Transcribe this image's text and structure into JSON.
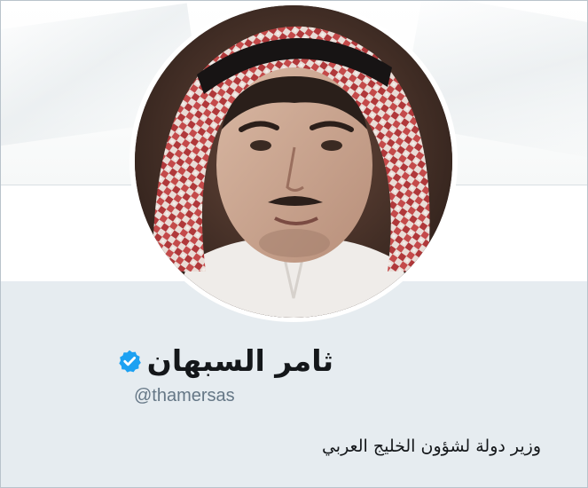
{
  "profile": {
    "display_name": "ثامر السبهان",
    "verified": true,
    "verified_badge_color": "#1da1f2",
    "handle": "@thamersas",
    "bio": "وزير دولة لشؤون الخليج العربي"
  },
  "colors": {
    "card_background": "#e6ecf0",
    "handle_text": "#657786",
    "primary_text": "#14171a"
  },
  "icons": {
    "verified": "verified-badge-icon"
  }
}
